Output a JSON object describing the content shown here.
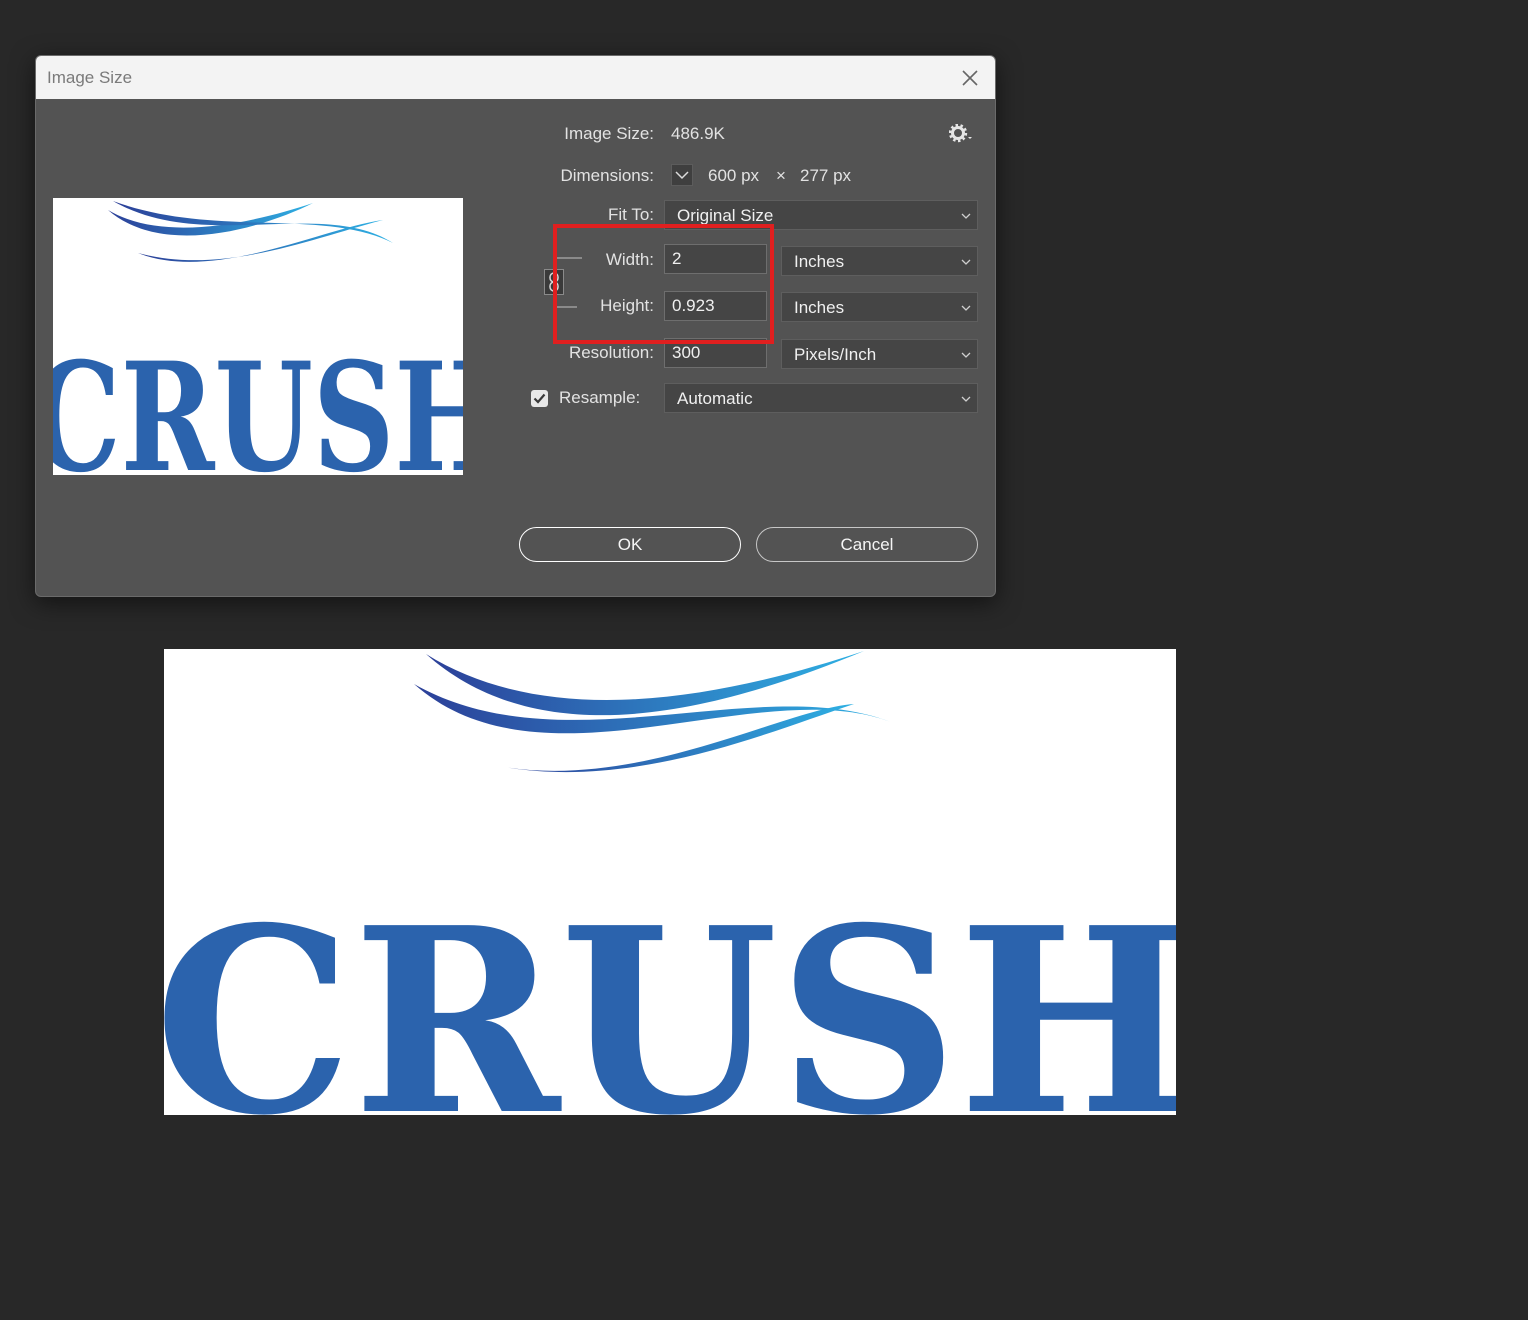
{
  "dialog": {
    "title": "Image Size",
    "image_size_label": "Image Size:",
    "image_size_value": "486.9K",
    "dimensions_label": "Dimensions:",
    "dimensions_width": "600 px",
    "dimensions_times": "×",
    "dimensions_height": "277 px",
    "fit_to_label": "Fit To:",
    "fit_to_value": "Original Size",
    "width_label": "Width:",
    "width_value": "2",
    "width_unit": "Inches",
    "height_label": "Height:",
    "height_value": "0.923",
    "height_unit": "Inches",
    "resolution_label": "Resolution:",
    "resolution_value": "300",
    "resolution_unit": "Pixels/Inch",
    "resample_label": "Resample:",
    "resample_value": "Automatic",
    "resample_checked": true,
    "ok_label": "OK",
    "cancel_label": "Cancel"
  },
  "artwork": {
    "text": "CRUSH",
    "text_color": "#2b63ad",
    "wave_color_dark": "#2c3f98",
    "wave_color_light": "#2eb0e3"
  },
  "colors": {
    "highlight": "#e01f1f",
    "dialog_bg": "#535353",
    "page_bg": "#282828"
  }
}
